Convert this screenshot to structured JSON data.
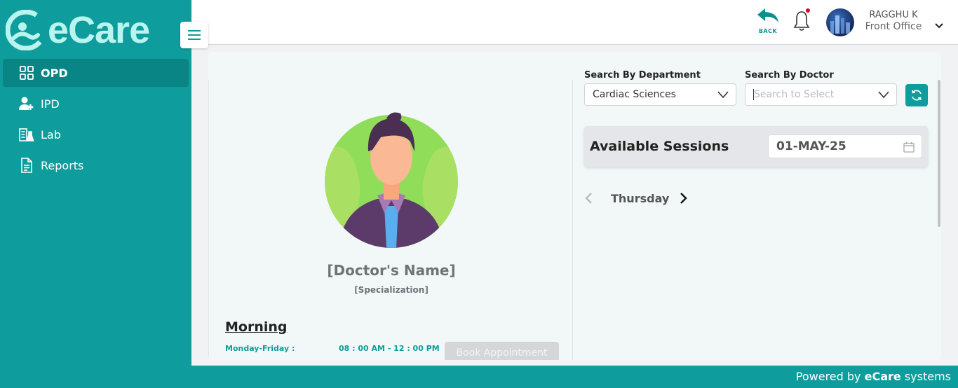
{
  "app": {
    "logo_text": "eCare"
  },
  "sidebar": {
    "items": [
      {
        "label": "OPD",
        "icon": "grid-icon",
        "active": true
      },
      {
        "label": "IPD",
        "icon": "user-plus-icon",
        "active": false
      },
      {
        "label": "Lab",
        "icon": "lab-building-icon",
        "active": false
      },
      {
        "label": "Reports",
        "icon": "document-icon",
        "active": false
      }
    ]
  },
  "header": {
    "back_label": "BACK",
    "user_name": "RAGGHU K",
    "user_role": "Front Office"
  },
  "doctor": {
    "name": "[Doctor's Name]",
    "specialization": "[Specialization]",
    "session_heading": "Morning",
    "days": "Monday-Friday :",
    "hours": "08 : 00 AM - 12 : 00 PM",
    "book_label": "Book Appointment"
  },
  "search": {
    "department_label": "Search By Department",
    "department_value": "Cardiac Sciences",
    "doctor_label": "Search By Doctor",
    "doctor_placeholder": "Search to Select"
  },
  "sessions": {
    "title": "Available Sessions",
    "date": "01-MAY-25",
    "day": "Thursday"
  },
  "footer": {
    "prefix": "Powered by ",
    "brand": "eCare",
    "suffix": " systems"
  },
  "colors": {
    "primary": "#0e9c9c",
    "notification_dot": "#e0002a"
  }
}
